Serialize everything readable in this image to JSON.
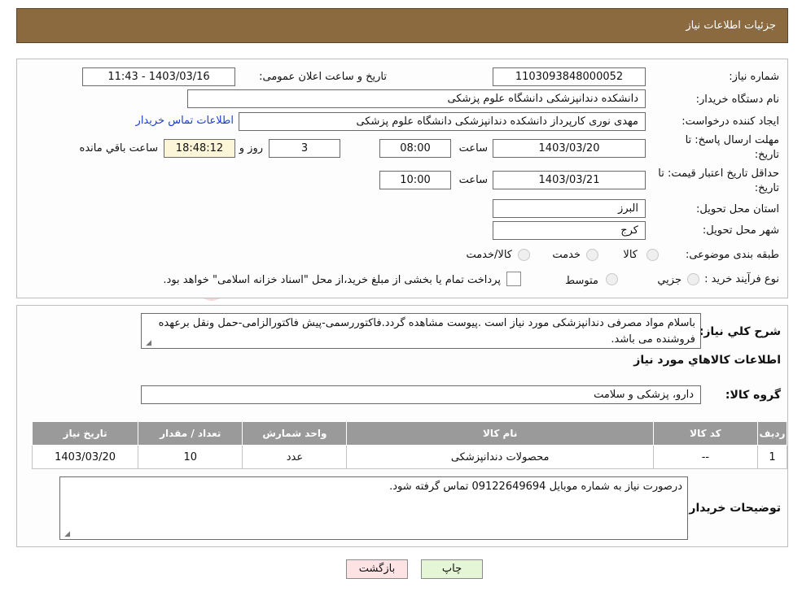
{
  "header": {
    "title": "جزئیات اطلاعات نیاز"
  },
  "form": {
    "need_number_label": "شماره نیاز:",
    "need_number": "1103093848000052",
    "announce_datetime_label": "تاریخ و ساعت اعلان عمومی:",
    "announce_datetime": "1403/03/16 - 11:43",
    "buyer_org_label": "نام دستگاه خریدار:",
    "buyer_org": "دانشکده دندانپزشکی دانشگاه علوم پزشکی",
    "requester_label": "ایجاد کننده درخواست:",
    "requester": "مهدی نوری کارپرداز دانشکده دندانپزشکی دانشگاه علوم پزشکی",
    "contact_link": "اطلاعات تماس خریدار",
    "reply_deadline_label_1": "مهلت ارسال پاسخ: تا",
    "reply_deadline_label_2": "تاریخ:",
    "reply_date": "1403/03/20",
    "time_label": "ساعت",
    "reply_time": "08:00",
    "days_value": "3",
    "days_label": "روز و",
    "remaining_time": "18:48:12",
    "remaining_label": "ساعت باقي مانده",
    "validity_label_1": "حداقل تاریخ اعتبار قیمت: تا",
    "validity_label_2": "تاریخ:",
    "validity_date": "1403/03/21",
    "validity_time": "10:00",
    "province_label": "استان محل تحویل:",
    "province": "البرز",
    "city_label": "شهر محل تحویل:",
    "city": "کرج",
    "category_label": "طبقه بندی موضوعی:",
    "category_options": [
      "کالا",
      "خدمت",
      "کالا/خدمت"
    ],
    "purchase_type_label": "نوع فرآیند خرید :",
    "purchase_options": [
      "جزيي",
      "متوسط"
    ],
    "payment_note": "پرداخت تمام یا بخشی از مبلغ خرید،از محل \"اسناد خزانه اسلامی\" خواهد بود."
  },
  "details": {
    "description_label": "شرح کلي نياز:",
    "description": "باسلام مواد مصرفی دندانپزشکی مورد نیاز است .پیوست مشاهده گردد.فاکتوررسمی-پیش فاکتورالزامی-حمل ونقل برعهده فروشنده می باشد.",
    "items_title": "اطلاعات کالاهاي مورد نياز",
    "group_label": "گروه کالا:",
    "group_value": "دارو، پزشکی و سلامت",
    "table_headers": [
      "رديف",
      "کد کالا",
      "نام کالا",
      "واحد شمارش",
      "تعداد / مقدار",
      "تاریخ نیاز"
    ],
    "table_rows": [
      [
        "1",
        "--",
        "محصولات دندانپزشکی",
        "عدد",
        "10",
        "1403/03/20"
      ]
    ],
    "buyer_notes_label": "توضیحات خریدار:",
    "buyer_notes": "درصورت نیاز به شماره موبایل 09122649694 تماس گرفته شود."
  },
  "buttons": {
    "print": "چاپ",
    "back": "بازگشت"
  },
  "watermark_text": "AriaTender.neT",
  "colors": {
    "header_bg": "#8b6a3f",
    "table_header_bg": "#9a9a9a",
    "back_button_bg": "#fde3e3",
    "print_button_bg": "#e4f6d5",
    "remaining_bg": "#fdf5d8"
  }
}
